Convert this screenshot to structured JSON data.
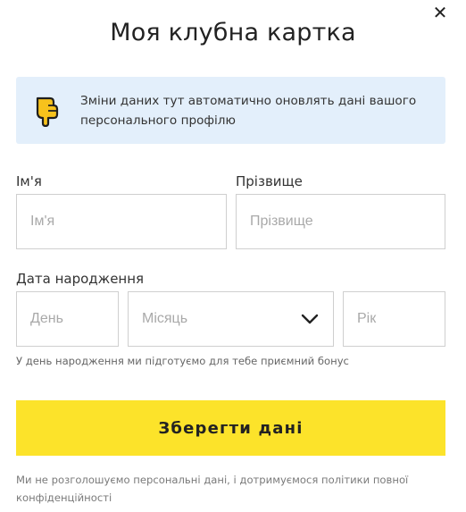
{
  "dialog": {
    "title": "Моя клубна картка",
    "close_icon": "close-icon"
  },
  "notice": {
    "icon": "pointing-hand-icon",
    "text": "Зміни даних тут автоматично оновлять дані вашого персонального профілю",
    "background": "#e3effb",
    "icon_color": "#f7c21c"
  },
  "form": {
    "first_name": {
      "label": "Ім'я",
      "placeholder": "Ім'я",
      "value": ""
    },
    "last_name": {
      "label": "Прізвище",
      "placeholder": "Прізвище",
      "value": ""
    },
    "birthdate": {
      "label": "Дата народження",
      "day_placeholder": "День",
      "month_placeholder": "Місяць",
      "year_placeholder": "Рік",
      "hint": "У день народження ми підготуємо для тебе приємний бонус"
    }
  },
  "actions": {
    "save_label": "Зберегти дані",
    "save_color": "#fce32a"
  },
  "footer": {
    "privacy_text": "Ми не розголошуємо персональні дані, і дотримуємося політики повної конфіденційності"
  }
}
